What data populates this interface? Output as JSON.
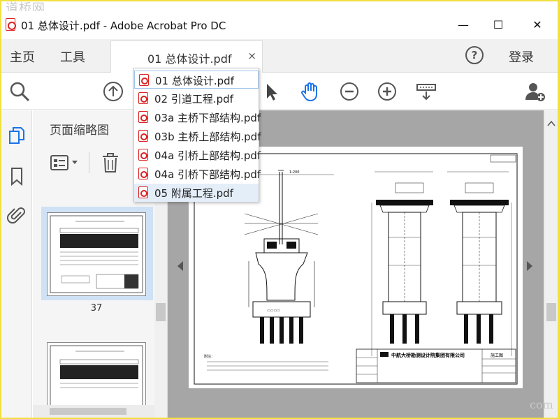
{
  "watermark": {
    "top_left": "道桥网",
    "bottom_right": "com"
  },
  "window": {
    "title": "01 总体设计.pdf - Adobe Acrobat Pro DC",
    "minimize": "—",
    "maximize": "☐",
    "close": "✕"
  },
  "tabs": {
    "home": "主页",
    "tools": "工具",
    "document": "01 总体设计.pdf",
    "document_close": "×",
    "help": "?",
    "login": "登录"
  },
  "dropdown": {
    "items": [
      "01 总体设计.pdf",
      "02 引道工程.pdf",
      "03a 主桥下部结构.pdf",
      "03b 主桥上部结构.pdf",
      "04a 引桥上部结构.pdf",
      "04a 引桥下部结构.pdf",
      "05 附属工程.pdf"
    ]
  },
  "thumbnails": {
    "panel_title": "页面缩略图",
    "page_label": "37"
  },
  "drawing": {
    "title_block_company": "中航大桥勘测设计院集团有限公司",
    "status": "施工图",
    "notes_title": "附注："
  },
  "colors": {
    "frame": "#f0e040",
    "accent": "#1a73e8",
    "pdf_red": "#dd2222"
  },
  "icons": [
    "search-icon",
    "upload-icon",
    "select-cursor-icon",
    "hand-icon",
    "zoom-out-icon",
    "zoom-in-icon",
    "scan-icon",
    "add-user-icon",
    "pages-icon",
    "bookmark-icon",
    "attachment-icon",
    "options-icon",
    "trash-icon"
  ]
}
